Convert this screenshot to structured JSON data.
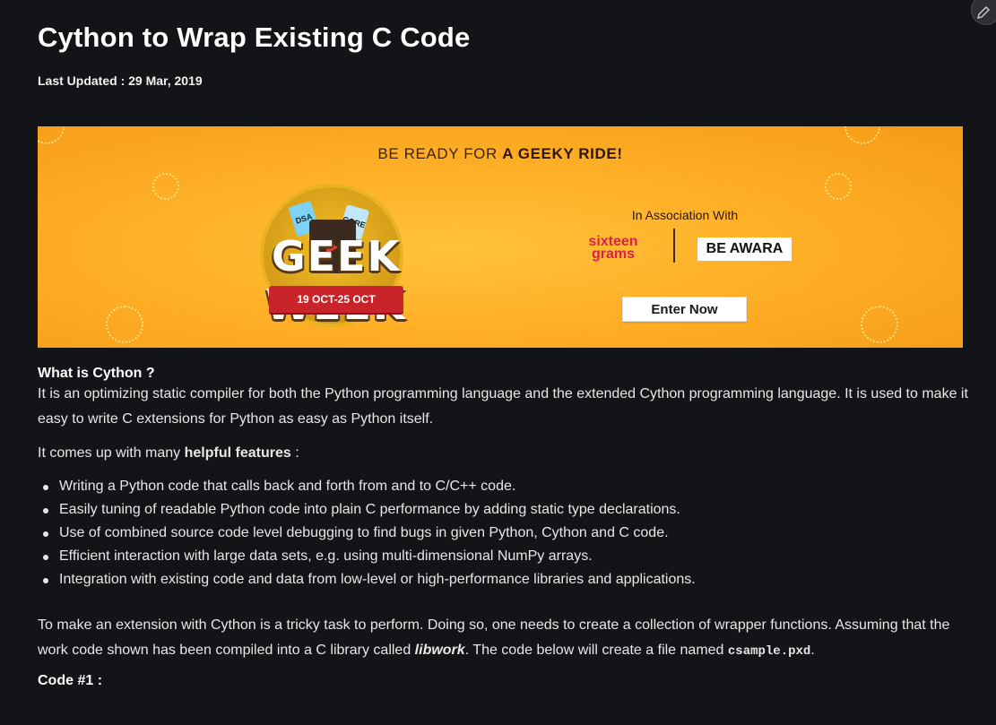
{
  "article": {
    "title": "Cython to Wrap Existing C Code",
    "last_updated": "Last Updated : 29 Mar, 2019"
  },
  "banner": {
    "headline_prefix": "BE READY FOR ",
    "headline_strong": "A GEEKY RIDE!",
    "event_name": "GEEK WEEK",
    "event_dates": "19 OCT-25 OCT",
    "ticket_left": "DSA",
    "ticket_right": "CORE",
    "association_text": "In Association With",
    "sponsor_1": "sixteen grams",
    "sponsor_2": "BE AWARA",
    "cta_label": "Enter Now",
    "background_color": "#ffb027"
  },
  "body": {
    "question": "What is Cython ?",
    "intro": "It is an optimizing static compiler for both the Python programming language and the extended Cython programming language. It is used to make it easy to write C extensions for Python as easy as Python itself.",
    "features_lead_prefix": "It comes up with many ",
    "features_lead_strong": "helpful features",
    "features_lead_suffix": " :",
    "features": [
      "Writing a Python code that calls back and forth from and to C/C++ code.",
      "Easily tuning of readable Python code into plain C performance by adding static type declarations.",
      "Use of combined source code level debugging to find bugs in given Python, Cython and C code.",
      "Efficient interaction with large data sets, e.g. using multi-dimensional NumPy arrays.",
      "Integration with existing code and data from low-level or high-performance libraries and applications."
    ],
    "extension_text_1": "To make an extension with Cython is a tricky task to perform. Doing so, one needs to create a collection of wrapper functions. Assuming that the work code shown has been compiled into a C library called ",
    "library_name": "libwork",
    "extension_text_2": ". The code below will create a file named ",
    "file_name": "csample.pxd",
    "extension_text_3": ".",
    "code_heading": "Code #1 :"
  },
  "icons": {
    "edit": "pencil-icon"
  }
}
